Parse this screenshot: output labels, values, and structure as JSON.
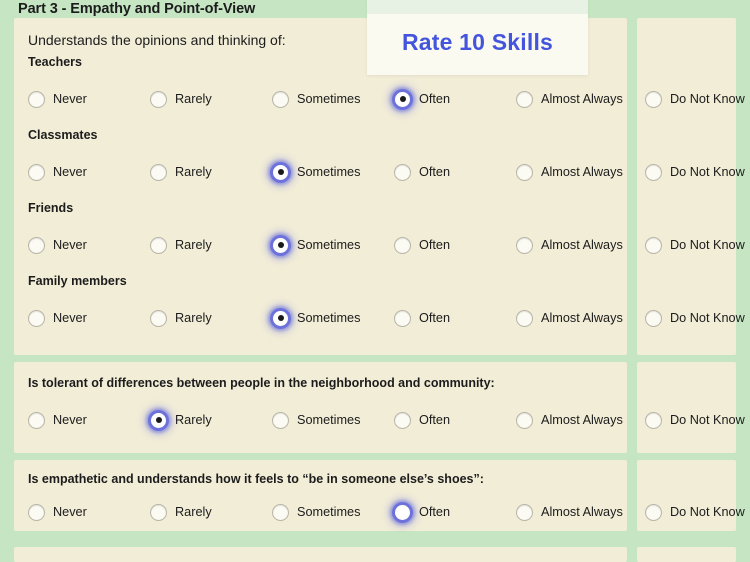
{
  "page": {
    "title": "Part 3 - Empathy and Point-of-View",
    "bg_color": "#C6E6C3",
    "panel_color": "#F2EDD7"
  },
  "overlay": {
    "label": "Rate 10 Skills",
    "text_color": "#4455DD",
    "bg_color": "#FBFAF0"
  },
  "scale": {
    "options": [
      "Never",
      "Rarely",
      "Sometimes",
      "Often",
      "Almost Always"
    ],
    "extra_option": "Do Not Know"
  },
  "sections": [
    {
      "lead": "Understands the opinions and thinking of:",
      "items": [
        {
          "label": "Teachers",
          "selected": "Often",
          "focused": "Often"
        },
        {
          "label": "Classmates",
          "selected": "Sometimes",
          "focused": "Sometimes"
        },
        {
          "label": "Friends",
          "selected": "Sometimes",
          "focused": "Sometimes"
        },
        {
          "label": "Family members",
          "selected": "Sometimes",
          "focused": "Sometimes"
        }
      ]
    },
    {
      "question": "Is tolerant of differences between people in the neighborhood and community:",
      "selected": "Rarely",
      "focused": "Rarely"
    },
    {
      "question": "Is empathetic and understands how it feels to “be in someone else’s shoes”:",
      "selected": "",
      "focused": "Often"
    }
  ]
}
